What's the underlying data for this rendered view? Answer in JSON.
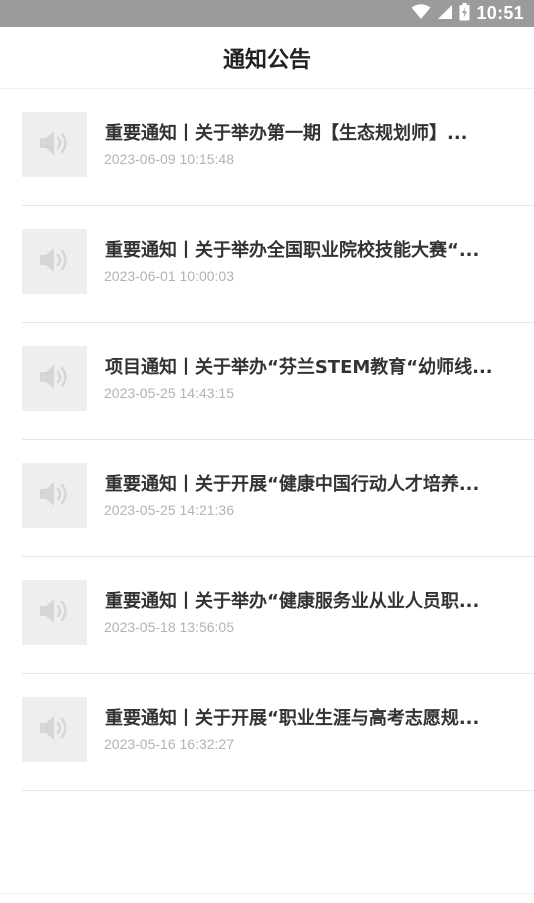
{
  "status_bar": {
    "time": "10:51",
    "icons": [
      "wifi-icon",
      "signal-icon",
      "battery-icon"
    ]
  },
  "header": {
    "title": "通知公告"
  },
  "notices": [
    {
      "title": "重要通知丨关于举办第一期【生态规划师】...",
      "time": "2023-06-09 10:15:48",
      "icon": "speaker-icon"
    },
    {
      "title": "重要通知丨关于举办全国职业院校技能大赛“...",
      "time": "2023-06-01 10:00:03",
      "icon": "speaker-icon"
    },
    {
      "title": "项目通知丨关于举办“芬兰STEM教育“幼师线...",
      "time": "2023-05-25 14:43:15",
      "icon": "speaker-icon"
    },
    {
      "title": "重要通知丨关于开展“健康中国行动人才培养...",
      "time": "2023-05-25 14:21:36",
      "icon": "speaker-icon"
    },
    {
      "title": "重要通知丨关于举办“健康服务业从业人员职...",
      "time": "2023-05-18 13:56:05",
      "icon": "speaker-icon"
    },
    {
      "title": "重要通知丨关于开展“职业生涯与高考志愿规...",
      "time": "2023-05-16 16:32:27",
      "icon": "speaker-icon"
    }
  ],
  "colors": {
    "status_bar_bg": "#9b9b9b",
    "title_text": "#222222",
    "item_title_text": "#333333",
    "item_time_text": "#b3b3b3",
    "thumb_bg": "#eeeeee",
    "icon_fill": "#d6d6d6"
  }
}
